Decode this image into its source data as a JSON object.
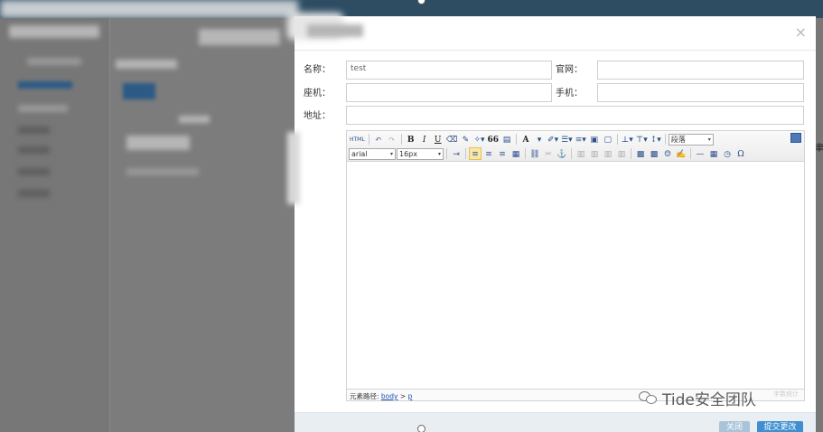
{
  "form": {
    "name_label": "名称：",
    "name_value": "test",
    "website_label": "官网：",
    "website_value": "",
    "phone_label": "座机：",
    "phone_value": "",
    "mobile_label": "手机：",
    "mobile_value": "",
    "address_label": "地址：",
    "address_value": ""
  },
  "editor": {
    "toolbar": {
      "html_label": "HTML",
      "quote_label": "66",
      "font_family": "arial",
      "font_size": "16px",
      "paragraph": "段落",
      "omega_label": "Ω",
      "textcolor_label": "A"
    },
    "path_label": "元素路径:",
    "path_body": "body",
    "path_sep": ">",
    "path_p": "p",
    "ghost_text": "字数统计"
  },
  "footer": {
    "close_label": "关闭",
    "submit_label": "提交更改"
  },
  "modal": {
    "close_icon_label": "×"
  },
  "watermark": {
    "text": "Tide安全团队"
  },
  "colors": {
    "topbar": "#2e4d63",
    "submit": "#3f8fd0",
    "close_btn": "#a9c3da"
  }
}
